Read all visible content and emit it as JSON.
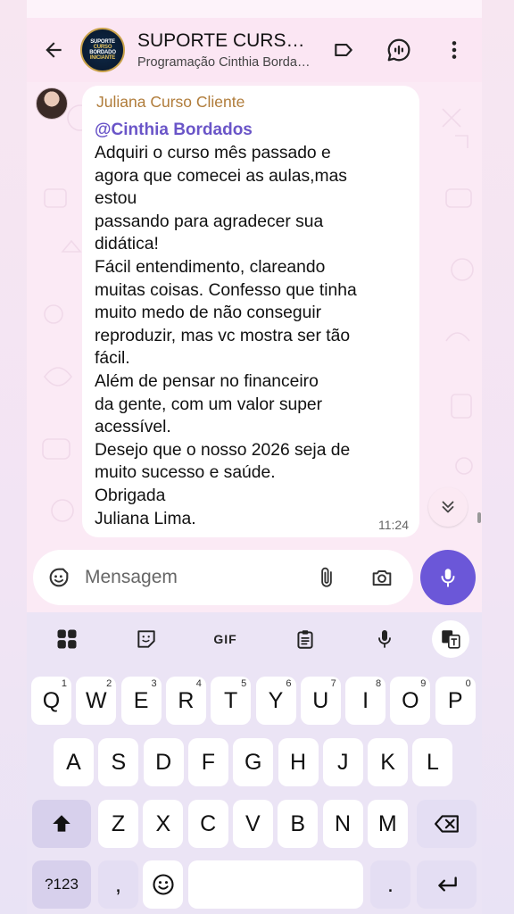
{
  "header": {
    "title": "SUPORTE CURSO BORDADO INICIANTE",
    "subtitle": "Programação Cinthia Bordados",
    "avatar_lines": [
      "SUPORTE",
      "CURSO",
      "BORDADO",
      "INICIANTE"
    ],
    "icons": [
      "back-arrow-icon",
      "label-icon",
      "voice-chat-icon",
      "more-vert-icon"
    ]
  },
  "message": {
    "sender": "Juliana Curso Cliente",
    "mention": "@Cinthia Bordados",
    "body": "Adquiri o curso mês passado e\nagora que comecei as aulas,mas\nestou\npassando para agradecer sua\ndidática!\nFácil entendimento, clareando\nmuitas coisas. Confesso que tinha\nmuito medo de não conseguir\nreproduzir, mas vc mostra ser tão\nfácil.\nAlém de pensar no financeiro\nda gente, com um valor super\nacessível.\nDesejo que o nosso 2026 seja de\nmuito sucesso e saúde.\nObrigada\nJuliana Lima.",
    "time": "11:24"
  },
  "composer": {
    "placeholder": "Mensagem",
    "value": ""
  },
  "keyboard": {
    "toolbar": {
      "gif": "GIF",
      "icons": [
        "apps-grid-icon",
        "sticker-icon",
        "gif-icon",
        "clipboard-icon",
        "mic-icon",
        "translate-icon"
      ]
    },
    "row1": [
      "Q",
      "W",
      "E",
      "R",
      "T",
      "Y",
      "U",
      "I",
      "O",
      "P"
    ],
    "row1_hints": [
      "1",
      "2",
      "3",
      "4",
      "5",
      "6",
      "7",
      "8",
      "9",
      "0"
    ],
    "row2": [
      "A",
      "S",
      "D",
      "F",
      "G",
      "H",
      "J",
      "K",
      "L"
    ],
    "row3": [
      "Z",
      "X",
      "C",
      "V",
      "B",
      "N",
      "M"
    ],
    "symbols_key": "?123",
    "comma_key": ",",
    "period_key": "."
  },
  "colors": {
    "accent": "#6b57d8",
    "mention": "#6a55c8",
    "sender_name": "#b07c3a",
    "header_bg": "#fbe6f3",
    "keyboard_bg": "#ebe4f5"
  }
}
